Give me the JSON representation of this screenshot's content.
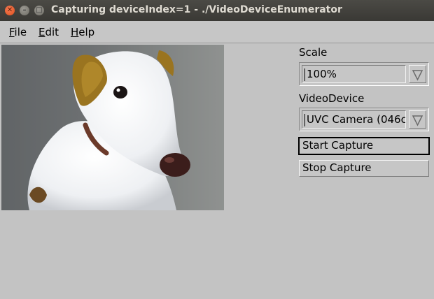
{
  "window": {
    "title": "Capturing deviceIndex=1  - ./VideoDeviceEnumerator"
  },
  "menu": {
    "file": {
      "mnemonic": "F",
      "rest": "ile"
    },
    "edit": {
      "mnemonic": "E",
      "rest": "dit"
    },
    "help": {
      "mnemonic": "H",
      "rest": "elp"
    }
  },
  "controls": {
    "scale_label": "Scale",
    "scale_value": "100%",
    "device_label": "VideoDevice",
    "device_value": "UVC Camera (046c",
    "start_label": "Start Capture",
    "stop_label": "Stop Capture"
  }
}
